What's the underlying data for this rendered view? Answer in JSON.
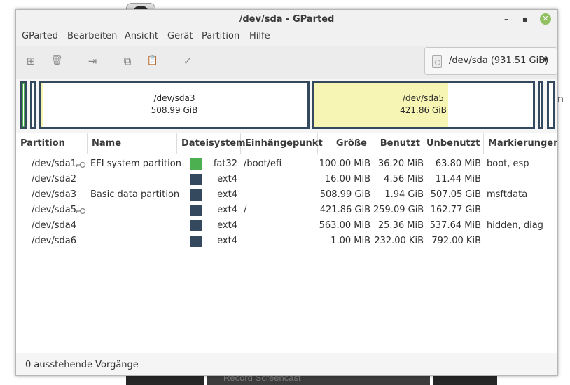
{
  "window": {
    "title": "/dev/sda - GParted",
    "minimize_label": "–",
    "maximize_label": "▪",
    "close_label": "✕"
  },
  "menu": [
    "GParted",
    "Bearbeiten",
    "Ansicht",
    "Gerät",
    "Partition",
    "Hilfe"
  ],
  "toolbar": {
    "new_icon": "⊞",
    "delete_icon": "🗑",
    "resize_icon": "⇥",
    "copy_icon": "⧉",
    "paste_icon": "📋",
    "apply_icon": "✓"
  },
  "device": {
    "label": "/dev/sda (931.51 GiB)",
    "arrow": "▼"
  },
  "graph": {
    "sda3": {
      "name": "/dev/sda3",
      "size": "508.99 GiB",
      "used_fraction": 0.004
    },
    "sda5": {
      "name": "/dev/sda5",
      "size": "421.86 GiB",
      "used_fraction": 0.614
    }
  },
  "table": {
    "headers": [
      "Partition",
      "Name",
      "Dateisystem",
      "Einhängepunkt",
      "Größe",
      "Benutzt",
      "Unbenutzt",
      "Markierungen"
    ],
    "rows": [
      {
        "partition": "/dev/sda1",
        "key": true,
        "name": "EFI system partition",
        "fs_color": "#4caf50",
        "filesystem": "fat32",
        "mount": "/boot/efi",
        "size": "100.00 MiB",
        "used": "36.20 MiB",
        "unused": "63.80 MiB",
        "flags": "boot, esp"
      },
      {
        "partition": "/dev/sda2",
        "key": false,
        "name": "",
        "fs_color": "#34495e",
        "filesystem": "ext4",
        "mount": "",
        "size": "16.00 MiB",
        "used": "4.56 MiB",
        "unused": "11.44 MiB",
        "flags": ""
      },
      {
        "partition": "/dev/sda3",
        "key": false,
        "name": "Basic data partition",
        "fs_color": "#34495e",
        "filesystem": "ext4",
        "mount": "",
        "size": "508.99 GiB",
        "used": "1.94 GiB",
        "unused": "507.05 GiB",
        "flags": "msftdata"
      },
      {
        "partition": "/dev/sda5",
        "key": true,
        "name": "",
        "fs_color": "#34495e",
        "filesystem": "ext4",
        "mount": "/",
        "size": "421.86 GiB",
        "used": "259.09 GiB",
        "unused": "162.77 GiB",
        "flags": ""
      },
      {
        "partition": "/dev/sda4",
        "key": false,
        "name": "",
        "fs_color": "#34495e",
        "filesystem": "ext4",
        "mount": "",
        "size": "563.00 MiB",
        "used": "25.36 MiB",
        "unused": "537.64 MiB",
        "flags": "hidden, diag"
      },
      {
        "partition": "/dev/sda6",
        "key": false,
        "name": "",
        "fs_color": "#34495e",
        "filesystem": "ext4",
        "mount": "",
        "size": "1.00 MiB",
        "used": "232.00 KiB",
        "unused": "792.00 KiB",
        "flags": ""
      }
    ]
  },
  "status": "0 ausstehende Vorgänge",
  "background": {
    "recorder_label": "Record Screencast",
    "edge_text": "n"
  }
}
